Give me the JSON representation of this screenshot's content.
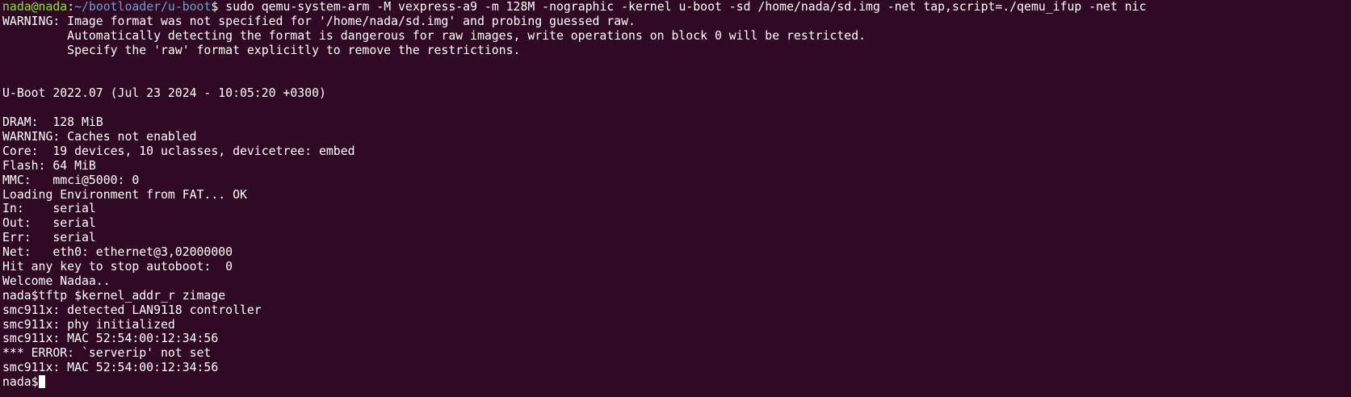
{
  "prompt": {
    "user_host": "nada@nada",
    "separator": ":",
    "cwd": "~/bootloader/u-boot",
    "symbol": "$",
    "command": " sudo qemu-system-arm -M vexpress-a9 -m 128M -nographic -kernel u-boot -sd /home/nada/sd.img -net tap,script=./qemu_ifup -net nic"
  },
  "output_lines": [
    "WARNING: Image format was not specified for '/home/nada/sd.img' and probing guessed raw.",
    "         Automatically detecting the format is dangerous for raw images, write operations on block 0 will be restricted.",
    "         Specify the 'raw' format explicitly to remove the restrictions.",
    "",
    "",
    "U-Boot 2022.07 (Jul 23 2024 - 10:05:20 +0300)",
    "",
    "DRAM:  128 MiB",
    "WARNING: Caches not enabled",
    "Core:  19 devices, 10 uclasses, devicetree: embed",
    "Flash: 64 MiB",
    "MMC:   mmci@5000: 0",
    "Loading Environment from FAT... OK",
    "In:    serial",
    "Out:   serial",
    "Err:   serial",
    "Net:   eth0: ethernet@3,02000000",
    "Hit any key to stop autoboot:  0",
    "Welcome Nadaa..",
    "nada$tftp $kernel_addr_r zimage",
    "smc911x: detected LAN9118 controller",
    "smc911x: phy initialized",
    "smc911x: MAC 52:54:00:12:34:56",
    "*** ERROR: `serverip' not set",
    "smc911x: MAC 52:54:00:12:34:56"
  ],
  "current_prompt": "nada$"
}
